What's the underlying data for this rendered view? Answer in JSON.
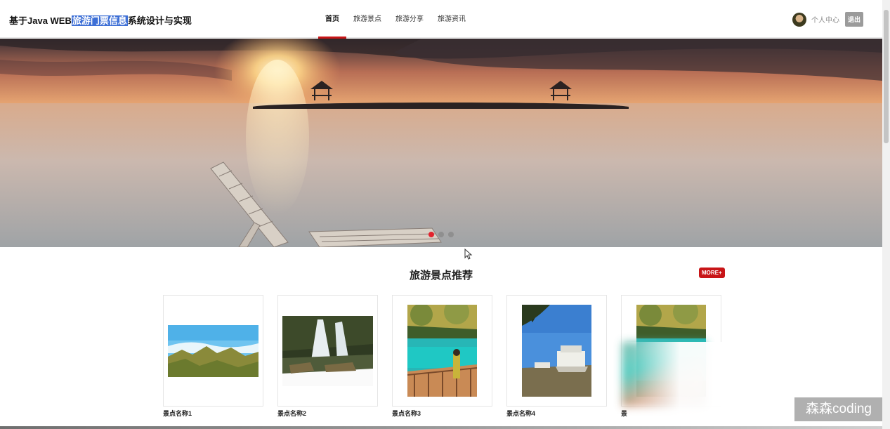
{
  "header": {
    "brand_prefix": "基于Java WEB",
    "brand_highlight": "旅游门票信息",
    "brand_suffix": "系统设计与实现",
    "nav": [
      {
        "label": "首页",
        "active": true
      },
      {
        "label": "旅游景点",
        "active": false
      },
      {
        "label": "旅游分享",
        "active": false
      },
      {
        "label": "旅游资讯",
        "active": false
      }
    ],
    "user_center": "个人中心",
    "logout": "退出",
    "accent_color": "#c81517"
  },
  "banner": {
    "slides": 3,
    "active_slide": 1
  },
  "section": {
    "title": "旅游景点推荐",
    "more": "MORE+",
    "items": [
      {
        "name": "景点名称1",
        "image": "mountain-landscape"
      },
      {
        "name": "景点名称2",
        "image": "waterfall"
      },
      {
        "name": "景点名称3",
        "image": "blue-lake-with-tourist"
      },
      {
        "name": "景点名称4",
        "image": "marble-boat-lake"
      },
      {
        "name": "景",
        "image": "blue-lake-with-tourist"
      }
    ]
  },
  "watermark": "森森coding"
}
